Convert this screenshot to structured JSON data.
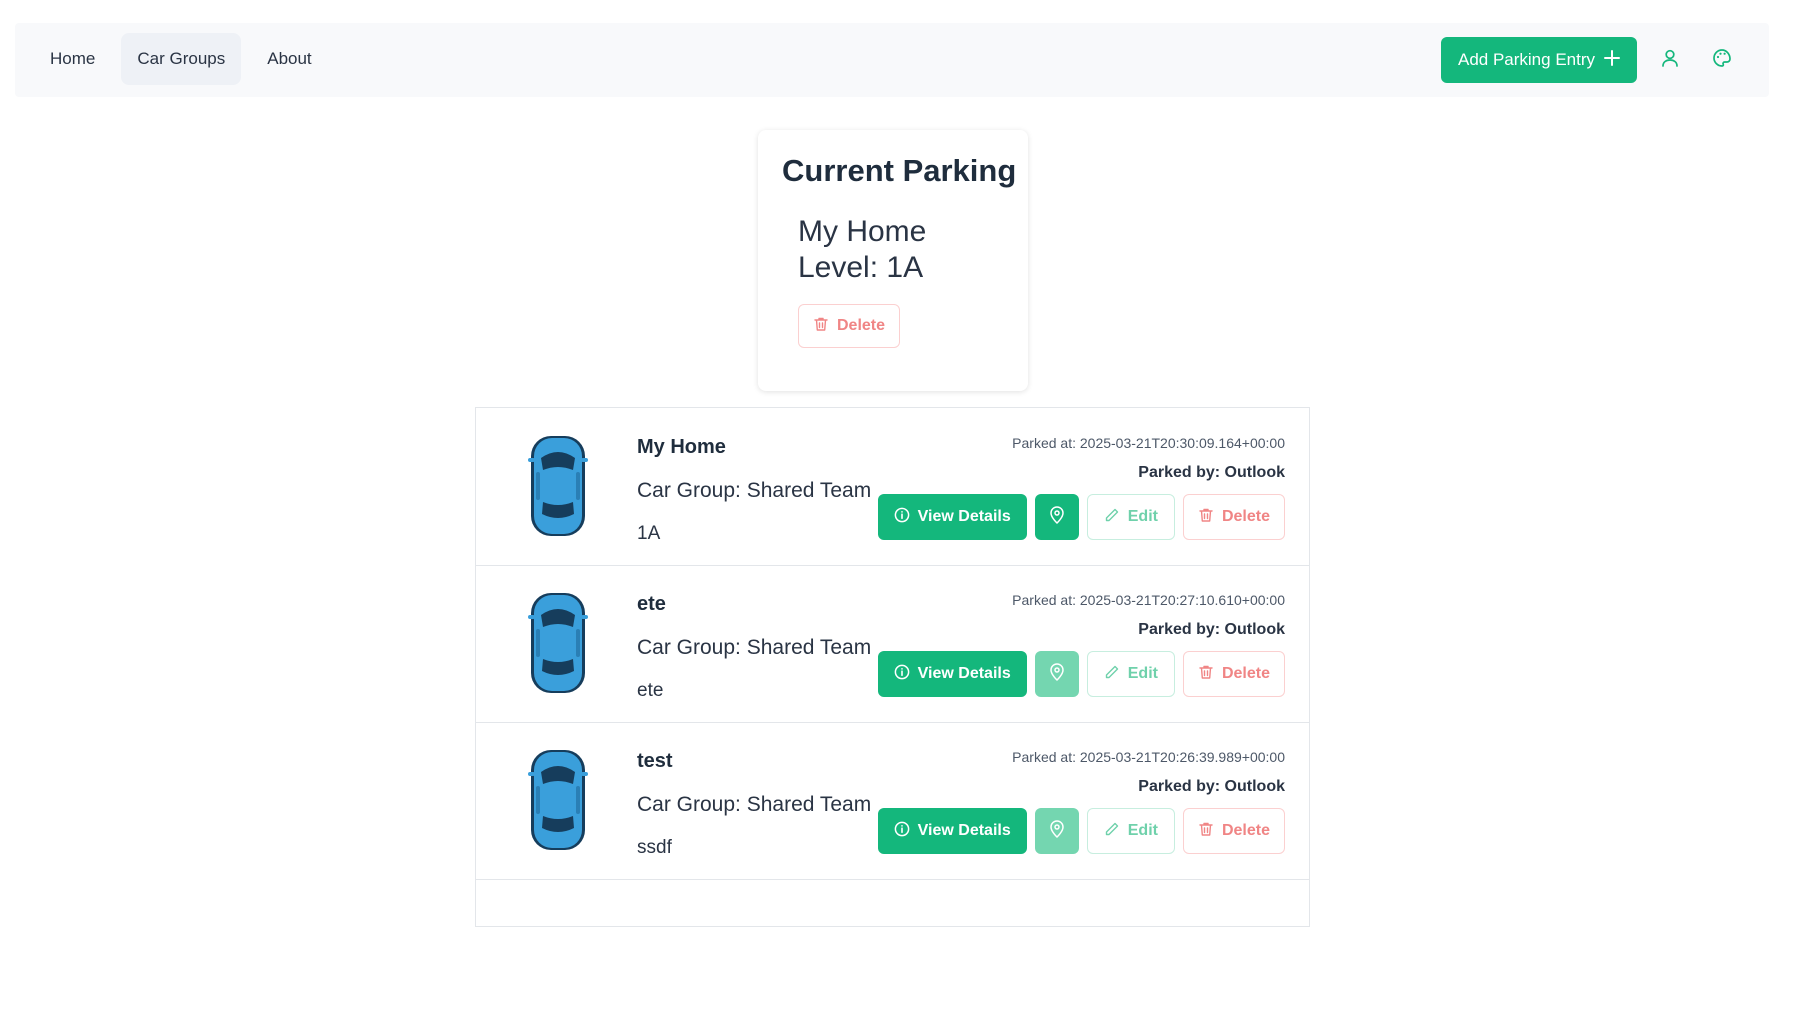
{
  "nav": {
    "links": [
      "Home",
      "Car Groups",
      "About"
    ],
    "add_button": "Add Parking Entry"
  },
  "current": {
    "title": "Current Parking",
    "name": "My Home",
    "level": "Level: 1A",
    "delete_label": "Delete"
  },
  "entries": [
    {
      "name": "My Home",
      "group": "Car Group: Shared Team",
      "level": "1A",
      "parked_at": "Parked at: 2025-03-21T20:30:09.164+00:00",
      "parked_by": "Parked by: Outlook",
      "view": "View Details",
      "edit": "Edit",
      "delete": "Delete"
    },
    {
      "name": "ete",
      "group": "Car Group: Shared Team",
      "level": "ete",
      "parked_at": "Parked at: 2025-03-21T20:27:10.610+00:00",
      "parked_by": "Parked by: Outlook",
      "view": "View Details",
      "edit": "Edit",
      "delete": "Delete"
    },
    {
      "name": "test",
      "group": "Car Group: Shared Team",
      "level": "ssdf",
      "parked_at": "Parked at: 2025-03-21T20:26:39.989+00:00",
      "parked_by": "Parked by: Outlook",
      "view": "View Details",
      "edit": "Edit",
      "delete": "Delete"
    }
  ],
  "icons": {
    "add": "plus-icon",
    "user": "user-icon",
    "theme": "palette-icon",
    "view": "info-icon",
    "location": "map-pin-icon",
    "edit": "pencil-icon",
    "delete": "trash-icon",
    "car": "car-top-view-icon"
  },
  "colors": {
    "primary": "#14b77c",
    "danger": "#f08585",
    "car_body": "#3a9fdb"
  }
}
